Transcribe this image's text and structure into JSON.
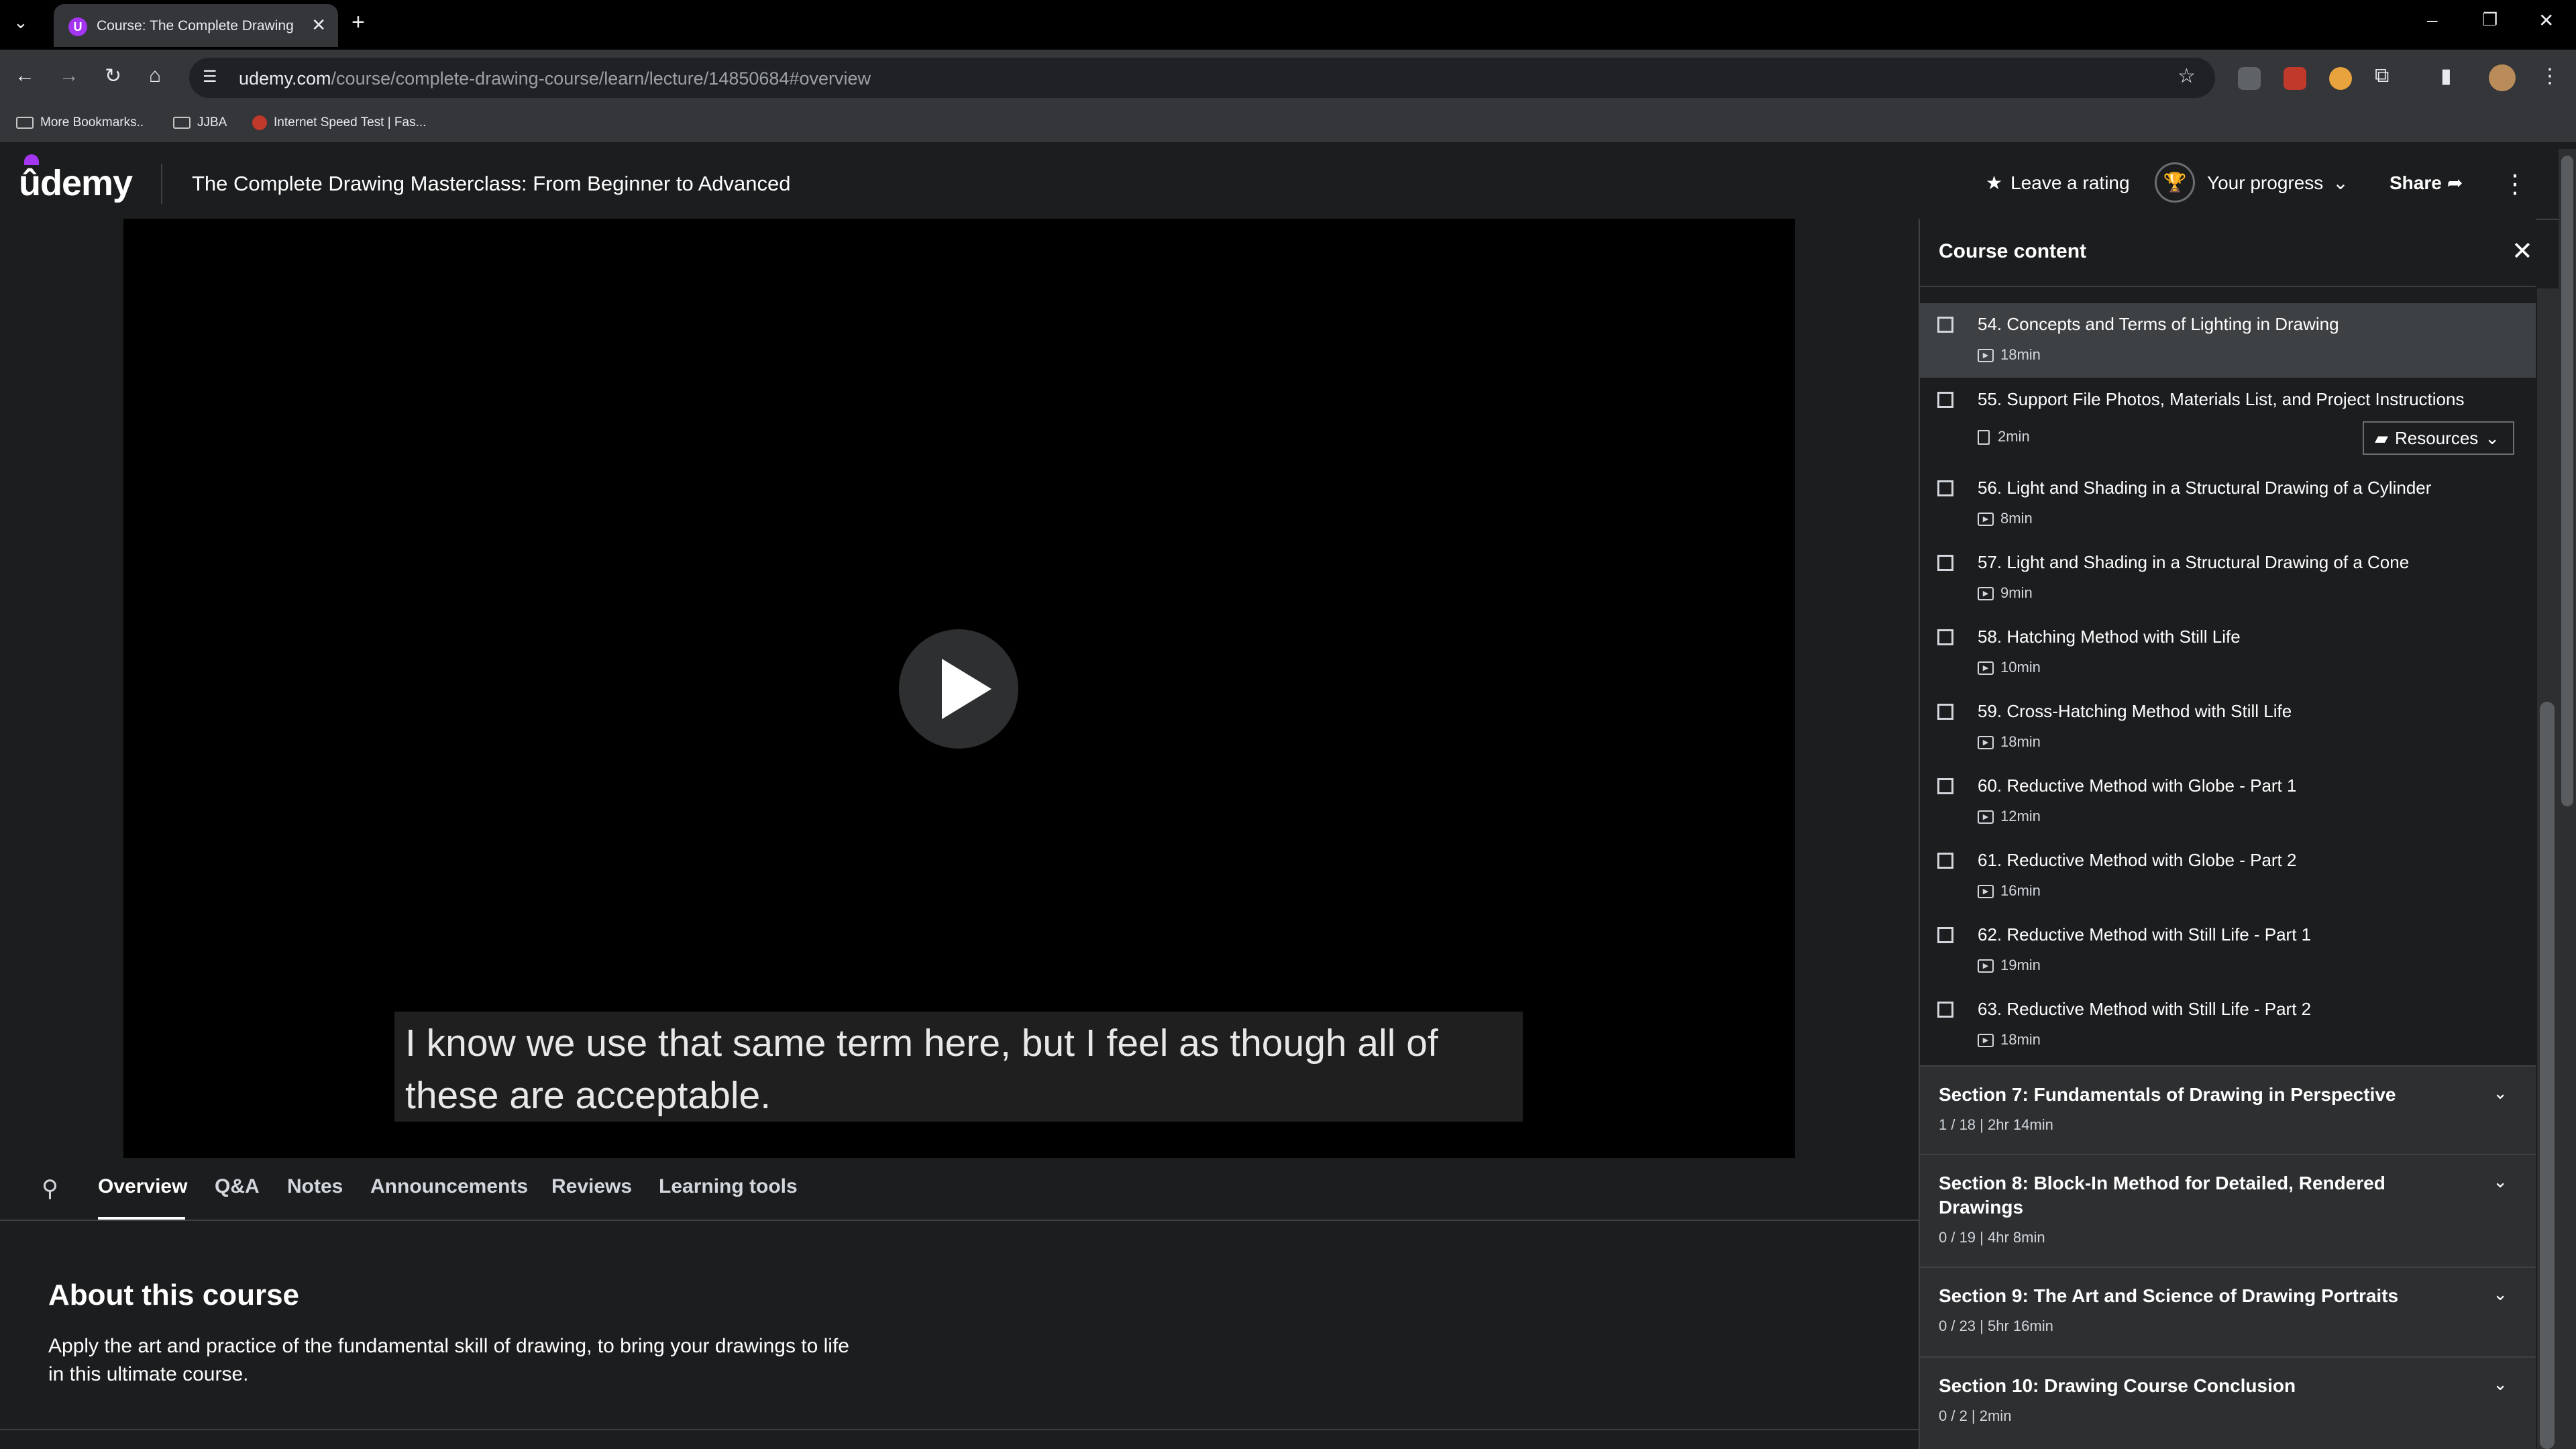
{
  "browser": {
    "tab_title": "Course: The Complete Drawing Maste",
    "url_host": "udemy.com",
    "url_path": "/course/complete-drawing-course/learn/lecture/14850684#overview",
    "bookmarks": [
      "More Bookmarks..",
      "JJBA",
      "Internet Speed Test | Fas..."
    ]
  },
  "header": {
    "logo": "ûdemy",
    "course_title": "The Complete Drawing Masterclass: From Beginner to Advanced",
    "rating_label": "Leave a rating",
    "progress_label": "Your progress",
    "share_label": "Share"
  },
  "player": {
    "caption_line1": "I know we use that same term here, but I feel as though all of",
    "caption_line2": "these are acceptable."
  },
  "content_tabs": [
    "Overview",
    "Q&A",
    "Notes",
    "Announcements",
    "Reviews",
    "Learning tools"
  ],
  "overview": {
    "heading": "About this course",
    "text": "Apply the art and practice of the fundamental skill of drawing, to bring your drawings to life in this ultimate course."
  },
  "sidebar": {
    "title": "Course content",
    "partial_duration": "2min",
    "resources_label": "Resources",
    "lectures": [
      {
        "title": "54. Concepts and Terms of Lighting in Drawing",
        "duration": "18min"
      },
      {
        "title": "55. Support File Photos, Materials List, and Project Instructions",
        "duration": "2min"
      },
      {
        "title": "56. Light and Shading in a Structural Drawing of a Cylinder",
        "duration": "8min"
      },
      {
        "title": "57. Light and Shading in a Structural Drawing of a Cone",
        "duration": "9min"
      },
      {
        "title": "58. Hatching Method with Still Life",
        "duration": "10min"
      },
      {
        "title": "59. Cross-Hatching Method with Still Life",
        "duration": "18min"
      },
      {
        "title": "60. Reductive Method with Globe - Part 1",
        "duration": "12min"
      },
      {
        "title": "61. Reductive Method with Globe - Part 2",
        "duration": "16min"
      },
      {
        "title": "62. Reductive Method with Still Life - Part 1",
        "duration": "19min"
      },
      {
        "title": "63. Reductive Method with Still Life - Part 2",
        "duration": "18min"
      }
    ],
    "sections": [
      {
        "title": "Section 7: Fundamentals of Drawing in Perspective",
        "stats": "1 / 18 | 2hr 14min"
      },
      {
        "title": "Section 8: Block-In Method for Detailed, Rendered Drawings",
        "stats": "0 / 19 | 4hr 8min"
      },
      {
        "title": "Section 9: The Art and Science of Drawing Portraits",
        "stats": "0 / 23 | 5hr 16min"
      },
      {
        "title": "Section 10: Drawing Course Conclusion",
        "stats": "0 / 2 | 2min"
      }
    ]
  },
  "colors": {
    "brand": "#a435f0",
    "background": "#1c1d1f",
    "panel": "#2d2f31"
  }
}
